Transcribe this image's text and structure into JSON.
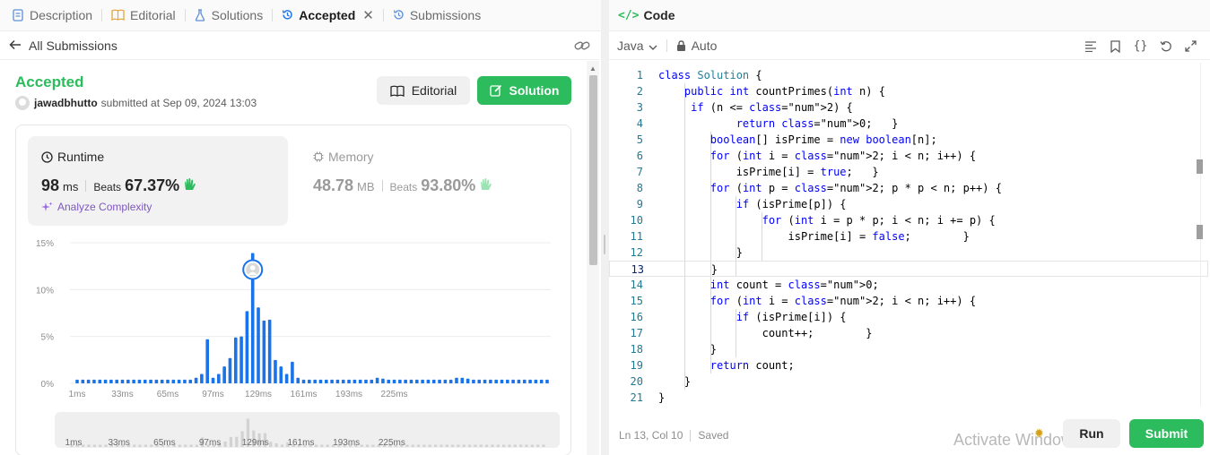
{
  "left_tabs": [
    {
      "label": "Description",
      "icon": "document-icon"
    },
    {
      "label": "Editorial",
      "icon": "book-icon"
    },
    {
      "label": "Solutions",
      "icon": "flask-icon"
    },
    {
      "label": "Accepted",
      "icon": "history-icon",
      "active": true
    },
    {
      "label": "Submissions",
      "icon": "history-icon"
    }
  ],
  "sub_bar": {
    "back_label": "All Submissions"
  },
  "submission": {
    "status": "Accepted",
    "user": "jawadbhutto",
    "submitted_text": "submitted at Sep 09, 2024 13:03"
  },
  "buttons": {
    "editorial": "Editorial",
    "solution": "Solution"
  },
  "runtime": {
    "label": "Runtime",
    "value": "98",
    "unit": "ms",
    "beats_label": "Beats",
    "beats": "67.37%",
    "analyze": "Analyze Complexity"
  },
  "memory": {
    "label": "Memory",
    "value": "48.78",
    "unit": "MB",
    "beats_label": "Beats",
    "beats": "93.80%"
  },
  "chart_data": {
    "type": "bar",
    "title": "",
    "xlabel": "",
    "ylabel": "",
    "ylim": [
      0,
      15
    ],
    "yticks": [
      "15%",
      "10%",
      "5%",
      "0%"
    ],
    "xticks": [
      "1ms",
      "33ms",
      "65ms",
      "97ms",
      "129ms",
      "161ms",
      "193ms",
      "225ms"
    ],
    "values": [
      0.4,
      0.4,
      0.4,
      0.4,
      0.4,
      0.4,
      0.4,
      0.4,
      0.4,
      0.4,
      0.4,
      0.4,
      0.4,
      0.4,
      0.4,
      0.4,
      0.4,
      0.4,
      0.4,
      0.4,
      0.4,
      0.6,
      1.0,
      4.7,
      0.6,
      1.0,
      1.8,
      2.7,
      4.9,
      5.0,
      7.7,
      13.9,
      8.1,
      6.7,
      6.8,
      2.5,
      1.8,
      1.0,
      2.3,
      0.6,
      0.4,
      0.4,
      0.4,
      0.4,
      0.4,
      0.4,
      0.4,
      0.4,
      0.4,
      0.4,
      0.4,
      0.4,
      0.4,
      0.6,
      0.5,
      0.4,
      0.4,
      0.4,
      0.4,
      0.4,
      0.4,
      0.4,
      0.4,
      0.4,
      0.4,
      0.4,
      0.4,
      0.6,
      0.6,
      0.5,
      0.4,
      0.4,
      0.4,
      0.4,
      0.4,
      0.4,
      0.4,
      0.4,
      0.4,
      0.4,
      0.4,
      0.4,
      0.4,
      0.4
    ],
    "highlight_index": 31,
    "bar_color": "#1a73e8",
    "mini_xticks": [
      "1ms",
      "33ms",
      "65ms",
      "97ms",
      "129ms",
      "161ms",
      "193ms",
      "225ms"
    ]
  },
  "editor": {
    "tab_label": "Code",
    "language": "Java",
    "mode": "Auto",
    "lines": [
      "class Solution {",
      "    public int countPrimes(int n) {",
      "     if (n <= 2) {",
      "            return 0;   }",
      "        boolean[] isPrime = new boolean[n];",
      "        for (int i = 2; i < n; i++) {",
      "            isPrime[i] = true;   }",
      "        for (int p = 2; p * p < n; p++) {",
      "            if (isPrime[p]) {",
      "                for (int i = p * p; i < n; i += p) {",
      "                    isPrime[i] = false;        }",
      "            }",
      "        }",
      "        int count = 0;",
      "        for (int i = 2; i < n; i++) {",
      "            if (isPrime[i]) {",
      "                count++;        }",
      "        }",
      "        return count;",
      "    }",
      "}"
    ],
    "current_line": 13
  },
  "footer": {
    "cursor": "Ln 13, Col 10",
    "saved": "Saved",
    "watermark": "Activate Windows",
    "run": "Run",
    "submit": "Submit"
  },
  "colors": {
    "accent_green": "#2cbb5d",
    "chart_blue": "#1a73e8",
    "analyze_purple": "#7e57c2"
  }
}
